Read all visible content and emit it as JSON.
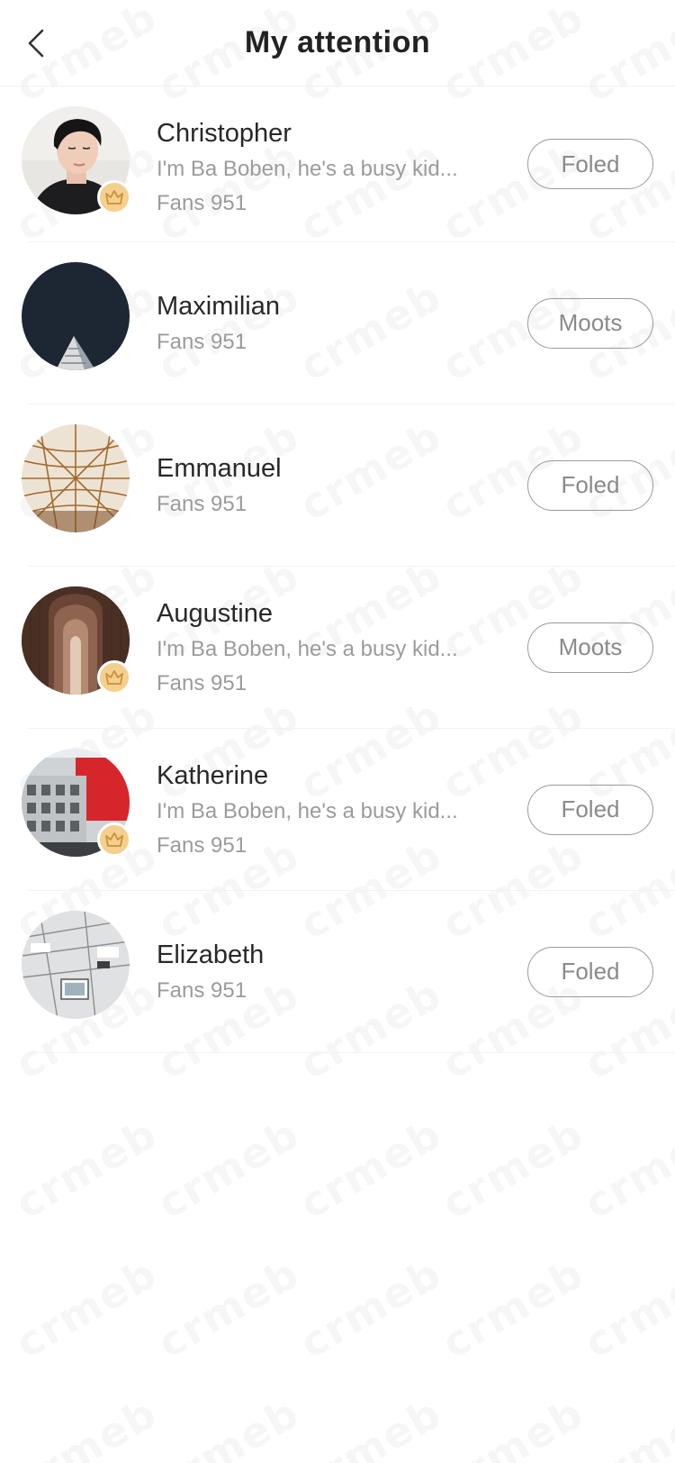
{
  "header": {
    "title": "My attention",
    "back_icon": "chevron-left-icon"
  },
  "watermark": "crmeb",
  "users": [
    {
      "name": "Christopher",
      "bio": "I'm Ba Boben, he's a busy kid...",
      "fans": "Fans 951",
      "button": "Foled",
      "vip": true
    },
    {
      "name": "Maximilian",
      "bio": "",
      "fans": "Fans 951",
      "button": "Moots",
      "vip": false
    },
    {
      "name": "Emmanuel",
      "bio": "",
      "fans": "Fans 951",
      "button": "Foled",
      "vip": false
    },
    {
      "name": "Augustine",
      "bio": "I'm Ba Boben, he's a busy kid...",
      "fans": "Fans 951",
      "button": "Moots",
      "vip": true
    },
    {
      "name": "Katherine",
      "bio": "I'm Ba Boben, he's a busy kid...",
      "fans": "Fans 951",
      "button": "Foled",
      "vip": true
    },
    {
      "name": "Elizabeth",
      "bio": "",
      "fans": "Fans 951",
      "button": "Foled",
      "vip": false
    }
  ],
  "colors": {
    "crown_badge": "#f5cf8d",
    "crown_stroke": "#c8923a",
    "muted_text": "#9b9b9b"
  }
}
